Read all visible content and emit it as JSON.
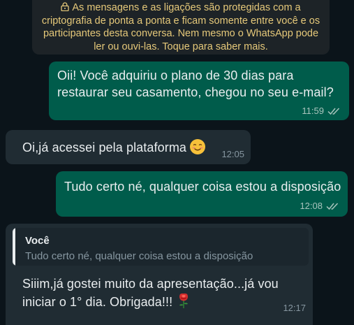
{
  "notice": {
    "icon": "lock-icon",
    "text": "As mensagens e as ligações são protegidas com a criptografia de ponta a ponta e ficam somente entre você e os participantes desta conversa. Nem mesmo o WhatsApp pode ler ou ouvi-las. Toque para saber mais."
  },
  "messages": [
    {
      "direction": "outgoing",
      "text": "Oii! Você adquiriu o plano de 30 dias para restaurar seu casamento, chegou no seu e-mail?",
      "time": "11:59",
      "status_icon": "double-check-icon"
    },
    {
      "direction": "incoming",
      "text": "Oi,já acessei pela plataforma",
      "emoji": "smiling-face-icon",
      "time": "12:05"
    },
    {
      "direction": "outgoing",
      "text": "Tudo certo né, qualquer coisa estou a disposição",
      "time": "12:08",
      "status_icon": "double-check-icon"
    },
    {
      "direction": "incoming",
      "reply": {
        "author": "Você",
        "text": "Tudo certo né, qualquer coisa estou a disposição"
      },
      "text": "Siiim,já gostei muito da apresentação...já vou iniciar o 1° dia. Obrigada!!!",
      "emoji": "rose-icon",
      "time": "12:17"
    }
  ],
  "colors": {
    "background": "#0b141a",
    "outgoing_bubble": "#005c4b",
    "incoming_bubble": "#202c33",
    "notice_text": "#e6c97a"
  }
}
